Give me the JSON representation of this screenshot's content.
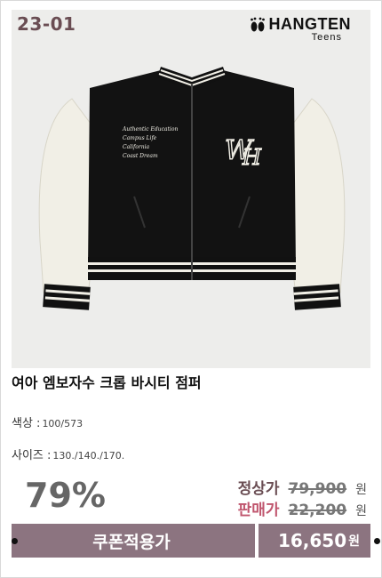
{
  "product": {
    "code": "23-01",
    "title": "여아 엠보자수 크롭 바시티 점퍼"
  },
  "brand": {
    "name": "HANGTEN",
    "sub": "Teens"
  },
  "specs": {
    "color_label": "색상 :",
    "color_value": "100/573",
    "size_label": "사이즈 :",
    "size_value": "130./140./170."
  },
  "pricing": {
    "discount": "79%",
    "regular_label": "정상가",
    "regular_price": "79,900",
    "sale_label": "판매가",
    "sale_price": "22,200",
    "currency": "원"
  },
  "cta": {
    "coupon_label": "쿠폰적용가",
    "final_price": "16,650",
    "currency": "원"
  },
  "colors": {
    "accent": "#8c7480",
    "code_color": "#6a4d53",
    "sale_label": "#c0566e"
  },
  "icons": [
    "footprint-logo-icon"
  ]
}
